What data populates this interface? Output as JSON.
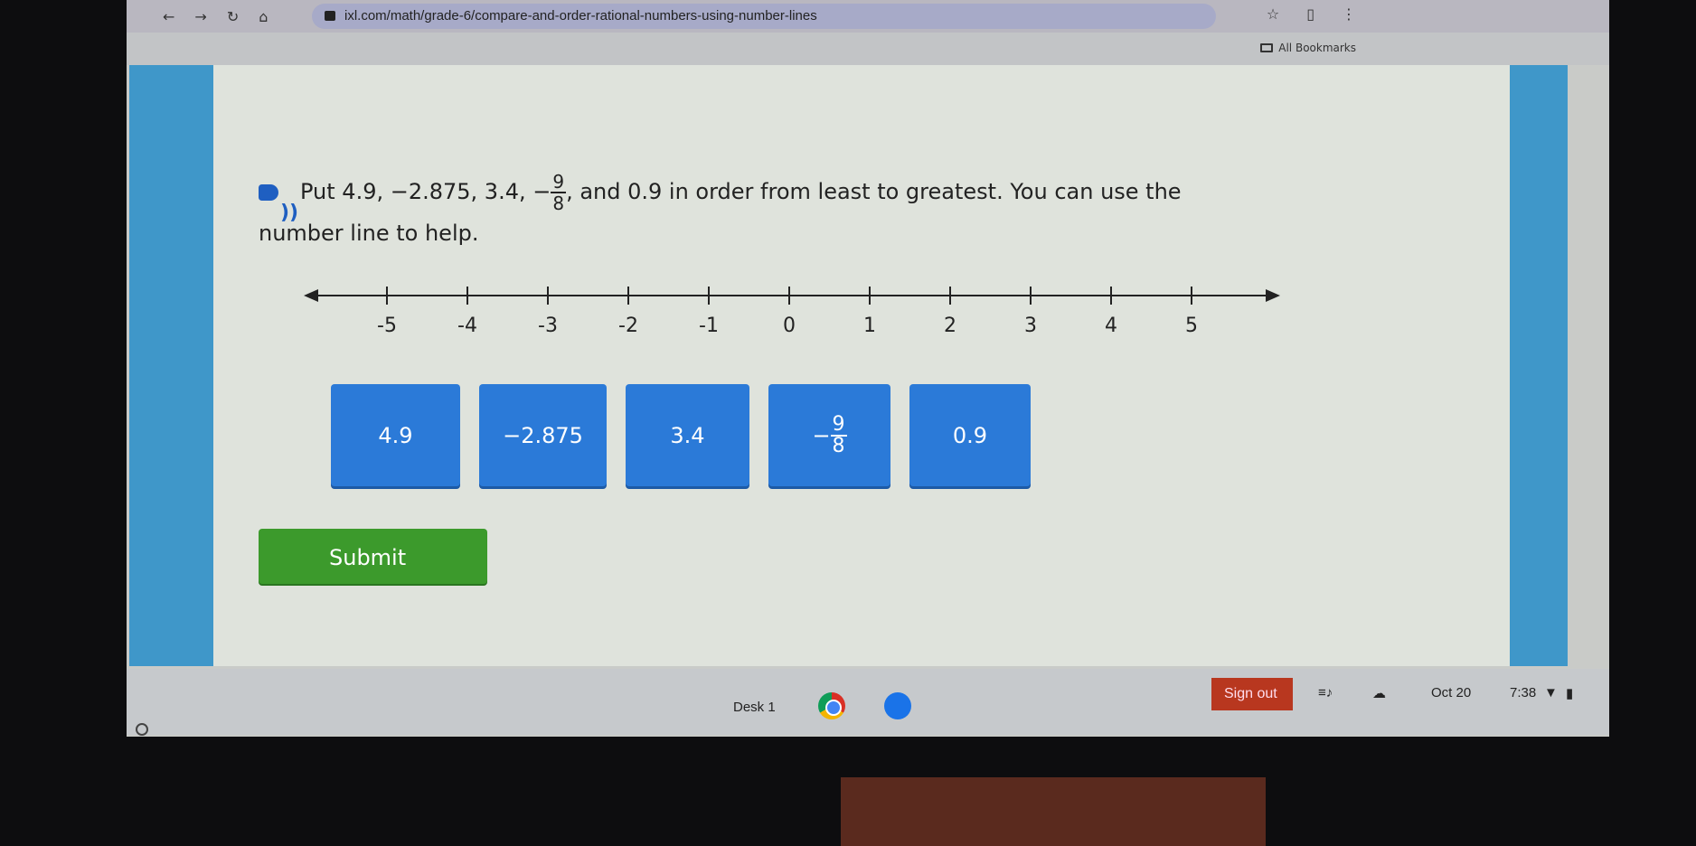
{
  "browser": {
    "url": "ixl.com/math/grade-6/compare-and-order-rational-numbers-using-number-lines",
    "nav_icons": [
      "back-arrow-icon",
      "forward-arrow-icon",
      "reload-icon",
      "home-icon"
    ],
    "bookmarks_label": "All Bookmarks"
  },
  "question": {
    "prefix": "Put 4.9, −2.875, 3.4, −",
    "frac_num": "9",
    "frac_den": "8",
    "suffix": ", and 0.9 in order from least to greatest. You can use the",
    "line2": "number line to help."
  },
  "number_line": {
    "tick_labels": [
      "-5",
      "-4",
      "-3",
      "-2",
      "-1",
      "0",
      "1",
      "2",
      "3",
      "4",
      "5"
    ]
  },
  "tiles": [
    {
      "label": "4.9"
    },
    {
      "label": "−2.875"
    },
    {
      "label": "3.4"
    },
    {
      "sign": "−",
      "num": "9",
      "den": "8"
    },
    {
      "label": "0.9"
    }
  ],
  "submit_label": "Submit",
  "taskbar": {
    "desk": "Desk 1",
    "sign_out": "Sign out",
    "date": "Oct 20",
    "time": "7:38"
  },
  "colors": {
    "tile": "#2b7ad8",
    "submit": "#3c9a2c",
    "sign_out": "#b8371f",
    "ixl_blue": "#3f97c9"
  }
}
